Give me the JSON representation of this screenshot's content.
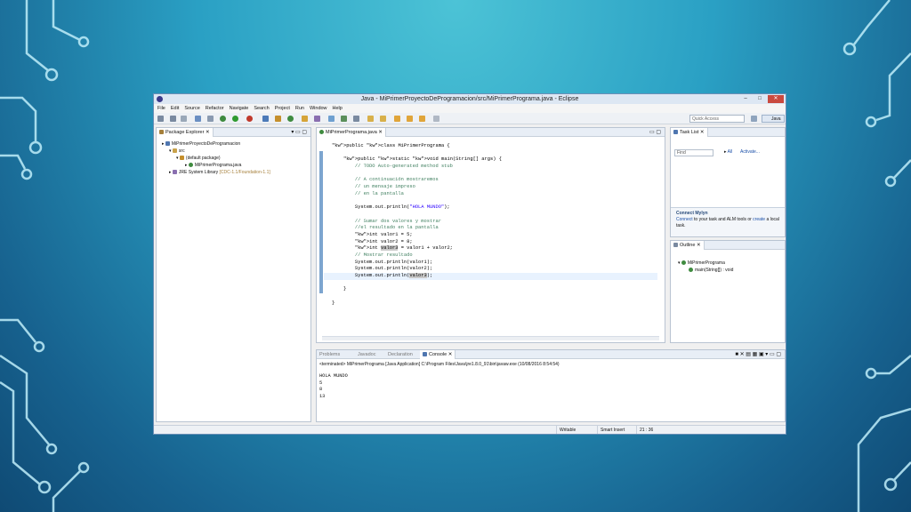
{
  "window": {
    "title": "Java - MiPrimerProyectoDeProgramacion/src/MiPrimerPrograma.java - Eclipse",
    "min_glyph": "–",
    "max_glyph": "□",
    "close_glyph": "✕"
  },
  "menu": [
    "File",
    "Edit",
    "Source",
    "Refactor",
    "Navigate",
    "Search",
    "Project",
    "Run",
    "Window",
    "Help"
  ],
  "toolbar": {
    "quick_access_placeholder": "Quick Access",
    "perspective_label": "Java"
  },
  "package_explorer": {
    "tab_label": "Package Explorer",
    "tree": [
      {
        "label": "MiPrimerProyectoDeProgramacion",
        "depth": 0
      },
      {
        "label": "src",
        "depth": 1
      },
      {
        "label": "(default package)",
        "depth": 2
      },
      {
        "label": "MiPrimerPrograma.java",
        "depth": 3
      }
    ],
    "jre_label": "JRE System Library",
    "jre_detail": "[CDC-1.1/Foundation-1.1]"
  },
  "editor": {
    "tab_label": "MiPrimerPrograma.java",
    "lines": [
      "public class MiPrimerPrograma {",
      "",
      "    public static void main(String[] args) {",
      "        // TODO Auto-generated method stub",
      "",
      "        // A continuación mostraremos",
      "        // un mensaje impreso",
      "        // en la pantalla",
      "",
      "        System.out.println(\"HOLA MUNDO\");",
      "",
      "        // Sumar dos valores y mostrar",
      "        //el resultado en la pantalla",
      "        int valor1 = 5;",
      "        int valor2 = 8;",
      "        int valor3 = valor1 + valor2;",
      "        // Mostrar resultado",
      "        System.out.println(valor1);",
      "        System.out.println(valor2);",
      "        System.out.println(valor3);",
      "",
      "    }",
      "",
      "}"
    ]
  },
  "task_list": {
    "tab_label": "Task List",
    "find_placeholder": "Find",
    "all_label": "All",
    "activate_label": "Activate..."
  },
  "mylyn": {
    "title": "Connect Mylyn",
    "link1": "Connect",
    "text1": "to your task and ALM tools or",
    "link2": "create",
    "text2": "a local task."
  },
  "outline": {
    "tab_label": "Outline",
    "class_name": "MiPrimerPrograma",
    "method": "main(String[]) : void"
  },
  "bottom_tabs": [
    "Problems",
    "Javadoc",
    "Declaration",
    "Console"
  ],
  "console": {
    "header": "<terminated> MiPrimerPrograma [Java Application] C:\\Program Files\\Java\\jre1.8.0_91\\bin\\javaw.exe (10/08/2016 8:54:54)",
    "output": [
      "HOLA MUNDO",
      "5",
      "8",
      "13"
    ]
  },
  "status": {
    "writable": "Writable",
    "insert_mode": "Smart Insert",
    "position": "21 : 36"
  }
}
